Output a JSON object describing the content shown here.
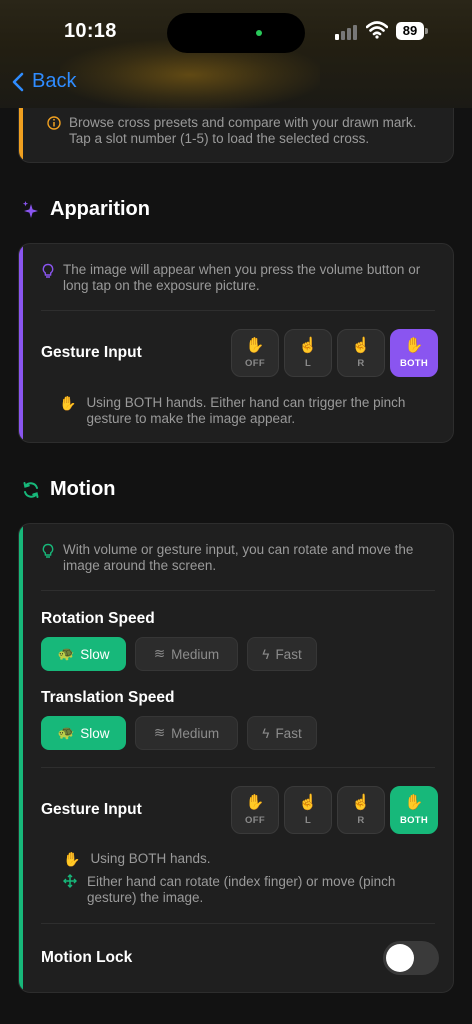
{
  "status_bar": {
    "time": "10:18",
    "battery": "89"
  },
  "nav": {
    "back_label": "Back"
  },
  "presets_card": {
    "note": "Browse cross presets and compare with your drawn mark. Tap a slot number (1-5) to load the selected cross."
  },
  "apparition": {
    "title": "Apparition",
    "note": "The image will appear when you press the volume button or long tap on the exposure picture.",
    "gesture_label": "Gesture Input",
    "gesture_options": [
      "OFF",
      "L",
      "R",
      "BOTH"
    ],
    "selected": "BOTH",
    "hint": "Using BOTH hands. Either hand can trigger the pinch gesture to make the image appear.",
    "accent": "#8a55f0"
  },
  "motion": {
    "title": "Motion",
    "note": "With volume or gesture input, you can rotate and move the image around the screen.",
    "rotation_label": "Rotation Speed",
    "translation_label": "Translation Speed",
    "speed_options": [
      "Slow",
      "Medium",
      "Fast"
    ],
    "rotation_selected": "Slow",
    "translation_selected": "Slow",
    "gesture_label": "Gesture Input",
    "gesture_options": [
      "OFF",
      "L",
      "R",
      "BOTH"
    ],
    "selected": "BOTH",
    "hint_1": "Using BOTH hands.",
    "hint_2": "Either hand can rotate (index finger) or move (pinch gesture) the image.",
    "lock_label": "Motion Lock",
    "lock_on": false,
    "accent": "#17b87a"
  }
}
